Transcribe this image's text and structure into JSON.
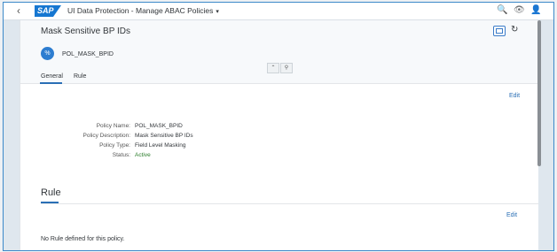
{
  "shell": {
    "logo_text": "SAP",
    "app_title": "UI Data Protection - Manage ABAC Policies",
    "title_caret": "▾",
    "back_icon": "‹",
    "search_icon": "🔍",
    "eye_icon": "👁",
    "user_icon": "👤"
  },
  "header": {
    "object_title": "Mask Sensitive BP IDs",
    "avatar_text": "%",
    "avatar_label": "POL_MASK_BPID",
    "refresh_icon": "↻",
    "collapse_icon": "⌃",
    "pin_icon": "⚲"
  },
  "tabs": [
    {
      "label": "General"
    },
    {
      "label": "Rule"
    }
  ],
  "general": {
    "edit_label": "Edit",
    "fields": [
      {
        "label": "Policy Name:",
        "value": "POL_MASK_BPID"
      },
      {
        "label": "Policy Description:",
        "value": "Mask Sensitive BP IDs"
      },
      {
        "label": "Policy Type:",
        "value": "Field Level Masking"
      },
      {
        "label": "Status:",
        "value": "Active"
      }
    ]
  },
  "rule": {
    "title": "Rule",
    "edit_label": "Edit",
    "empty_text": "No Rule defined for this policy."
  },
  "colors": {
    "accent": "#2a6fb5",
    "status_active": "#2b7d2b",
    "brand": "#1677d1"
  }
}
